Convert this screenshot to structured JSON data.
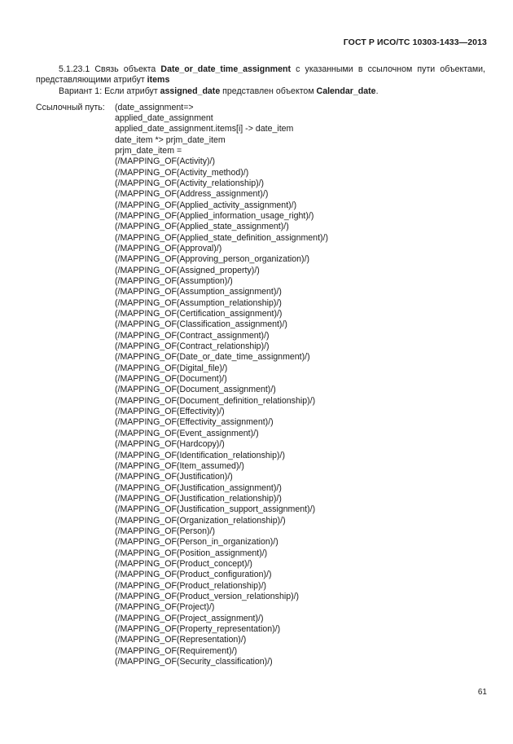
{
  "header": {
    "standard_title": "ГОСТ Р ИСО/ТС 10303-1433—2013"
  },
  "clause": {
    "number": "5.1.23.1",
    "paragraph_1_part1": "5.1.23.1 Связь объекта ",
    "paragraph_1_bold1": "Date_or_date_time_assignment",
    "paragraph_1_part2": " с указанными в ссылочном пути объектами, представляющими атрибут ",
    "paragraph_1_bold2": "items",
    "paragraph_2_part1": "Вариант 1: Если атрибут ",
    "paragraph_2_bold1": "assigned_date",
    "paragraph_2_part2": " представлен объектом ",
    "paragraph_2_bold2": "Calendar_date",
    "paragraph_2_part3": "."
  },
  "reference_path": {
    "label": "Ссылочный путь:",
    "lines": [
      "(date_assignment=>",
      "applied_date_assignment",
      "applied_date_assignment.items[i] -> date_item",
      "date_item *> prjm_date_item",
      "prjm_date_item =",
      "(/MAPPING_OF(Activity)/)",
      "(/MAPPING_OF(Activity_method)/)",
      "(/MAPPING_OF(Activity_relationship)/)",
      "(/MAPPING_OF(Address_assignment)/)",
      "(/MAPPING_OF(Applied_activity_assignment)/)",
      "(/MAPPING_OF(Applied_information_usage_right)/)",
      "(/MAPPING_OF(Applied_state_assignment)/)",
      "(/MAPPING_OF(Applied_state_definition_assignment)/)",
      "(/MAPPING_OF(Approval)/)",
      "(/MAPPING_OF(Approving_person_organization)/)",
      "(/MAPPING_OF(Assigned_property)/)",
      "(/MAPPING_OF(Assumption)/)",
      "(/MAPPING_OF(Assumption_assignment)/)",
      "(/MAPPING_OF(Assumption_relationship)/)",
      "(/MAPPING_OF(Certification_assignment)/)",
      "(/MAPPING_OF(Classification_assignment)/)",
      "(/MAPPING_OF(Contract_assignment)/)",
      "(/MAPPING_OF(Contract_relationship)/)",
      "(/MAPPING_OF(Date_or_date_time_assignment)/)",
      "(/MAPPING_OF(Digital_file)/)",
      "(/MAPPING_OF(Document)/)",
      "(/MAPPING_OF(Document_assignment)/)",
      "(/MAPPING_OF(Document_definition_relationship)/)",
      "(/MAPPING_OF(Effectivity)/)",
      "(/MAPPING_OF(Effectivity_assignment)/)",
      "(/MAPPING_OF(Event_assignment)/)",
      "(/MAPPING_OF(Hardcopy)/)",
      "(/MAPPING_OF(Identification_relationship)/)",
      "(/MAPPING_OF(Item_assumed)/)",
      "(/MAPPING_OF(Justification)/)",
      "(/MAPPING_OF(Justification_assignment)/)",
      "(/MAPPING_OF(Justification_relationship)/)",
      "(/MAPPING_OF(Justification_support_assignment)/)",
      "(/MAPPING_OF(Organization_relationship)/)",
      "(/MAPPING_OF(Person)/)",
      "(/MAPPING_OF(Person_in_organization)/)",
      "(/MAPPING_OF(Position_assignment)/)",
      "(/MAPPING_OF(Product_concept)/)",
      "(/MAPPING_OF(Product_configuration)/)",
      "(/MAPPING_OF(Product_relationship)/)",
      "(/MAPPING_OF(Product_version_relationship)/)",
      "(/MAPPING_OF(Project)/)",
      "(/MAPPING_OF(Project_assignment)/)",
      "(/MAPPING_OF(Property_representation)/)",
      "(/MAPPING_OF(Representation)/)",
      "(/MAPPING_OF(Requirement)/)",
      "(/MAPPING_OF(Security_classification)/)"
    ]
  },
  "footer": {
    "page_number": "61"
  }
}
